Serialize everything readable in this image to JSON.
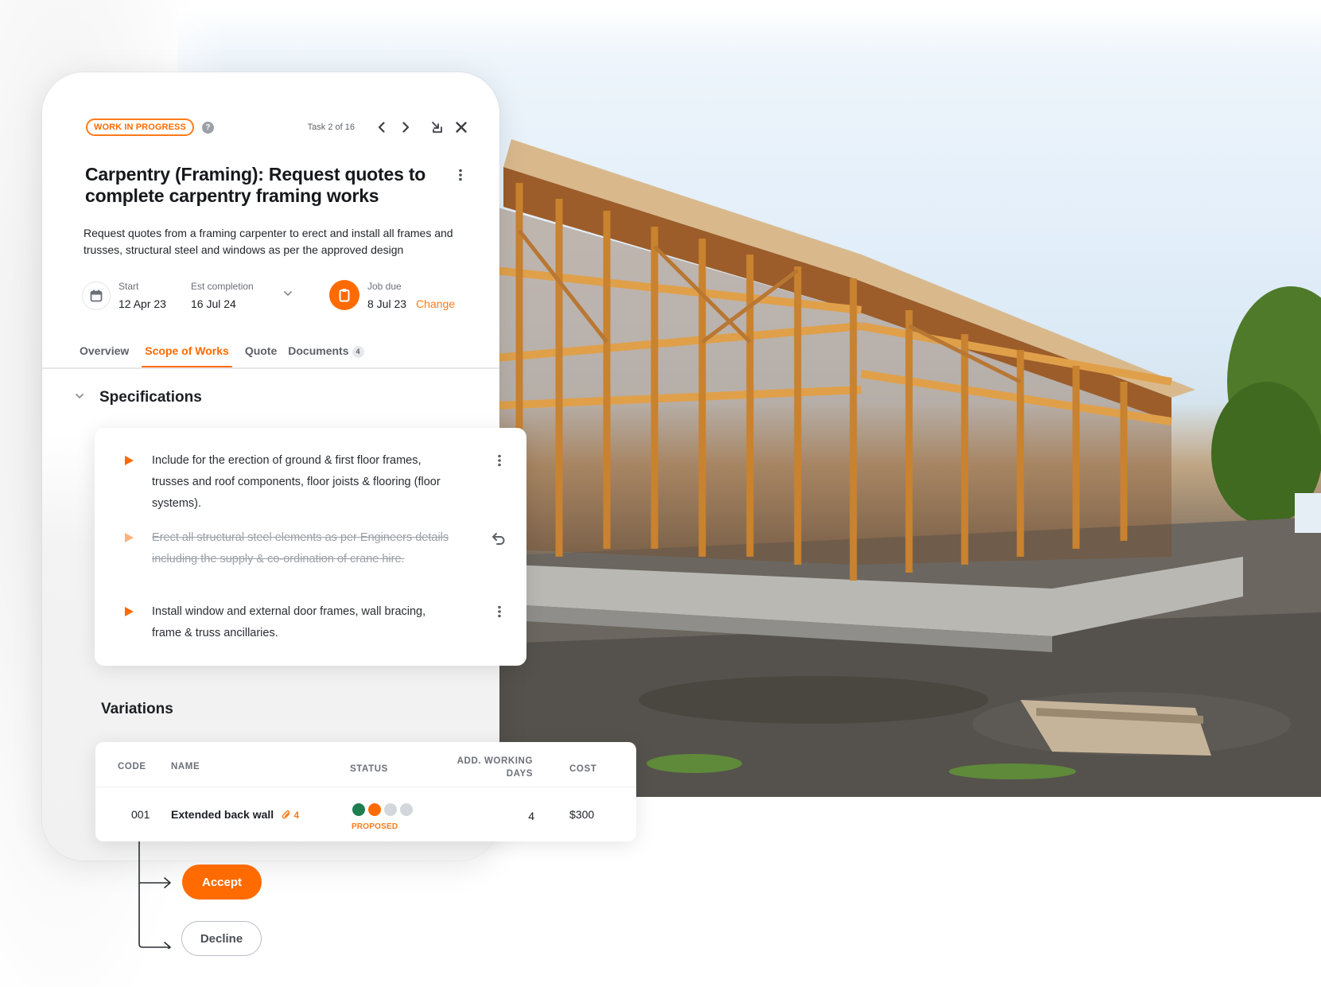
{
  "task": {
    "status_badge": "WORK IN PROGRESS",
    "help_icon": "question-icon",
    "counter": "Task 2 of 16",
    "title": "Carpentry (Framing): Request quotes to complete carpentry framing works",
    "description": "Request quotes from a framing carpenter to erect and install all frames and trusses, structural steel and windows as per the approved design",
    "icons": {
      "prev": "chevron-left-icon",
      "next": "chevron-right-icon",
      "minimize": "minimize-icon",
      "close": "close-icon",
      "more": "kebab-icon"
    }
  },
  "dates": {
    "start_label": "Start",
    "start_value": "12 Apr 23",
    "est_label": "Est completion",
    "est_value": "16 Jul 24",
    "due_label": "Job due",
    "due_value": "8 Jul 23",
    "change_label": "Change"
  },
  "tabs": [
    {
      "label": "Overview",
      "active": false
    },
    {
      "label": "Scope of Works",
      "active": true
    },
    {
      "label": "Quote",
      "active": false
    },
    {
      "label": "Documents",
      "active": false,
      "count": "4"
    }
  ],
  "specifications": {
    "title": "Specifications",
    "items": [
      {
        "text": "Include for the erection of ground & first floor frames, trusses and roof components, floor joists & flooring (floor systems).",
        "struck": false,
        "action": "kebab-icon"
      },
      {
        "text": "Erect all structural steel elements as per Engineers details including the supply & co-ordination of crane hire.",
        "struck": true,
        "action": "undo-icon"
      },
      {
        "text": "Install window and external door frames, wall bracing, frame & truss ancillaries.",
        "struck": false,
        "action": "kebab-icon"
      }
    ]
  },
  "variations": {
    "title": "Variations",
    "columns": {
      "code": "CODE",
      "name": "NAME",
      "status": "STATUS",
      "days_line1": "ADD. WORKING",
      "days_line2": "DAYS",
      "cost": "COST"
    },
    "rows": [
      {
        "code": "001",
        "name": "Extended back wall",
        "attachments": "4",
        "status": "PROPOSED",
        "status_steps": [
          "#1e7e52",
          "#ff6b00",
          "#d3d7dc",
          "#d3d7dc"
        ],
        "days": "4",
        "cost": "$300"
      }
    ]
  },
  "actions": {
    "accept": "Accept",
    "decline": "Decline"
  },
  "colors": {
    "accent": "#ff6b00",
    "approved": "#1e7e52",
    "pending": "#d3d7dc"
  }
}
